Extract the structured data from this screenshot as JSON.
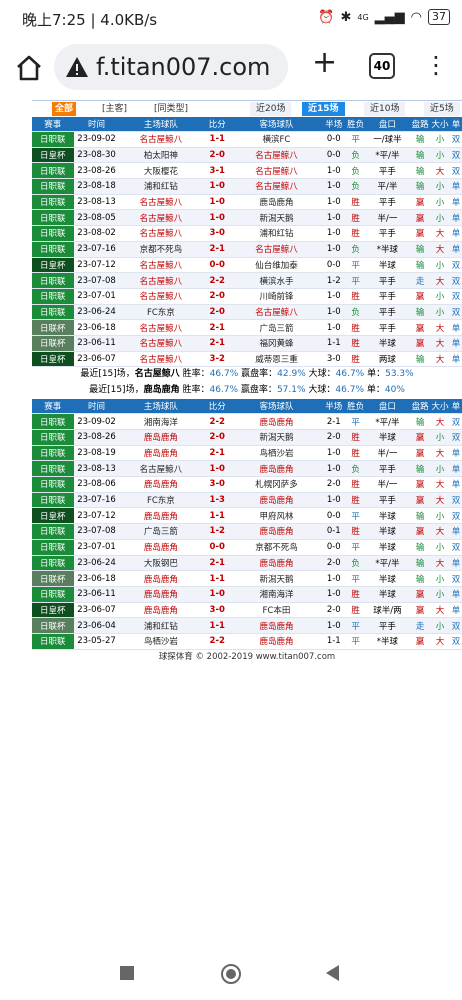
{
  "status": {
    "time": "晚上7:25 | 4.0KB/s",
    "signal": "4G",
    "battery": "37"
  },
  "browser": {
    "url": "f.titan007.com",
    "tab_count": "40"
  },
  "filters": {
    "all": "全部",
    "home_away": "[主客]",
    "same_type": "[同类型]",
    "counts": [
      "近20场",
      "近15场",
      "近10场",
      "近5场"
    ],
    "active": "近15场"
  },
  "columns": [
    "赛事",
    "时间",
    "主场球队",
    "比分",
    "客场球队",
    "半场",
    "胜负",
    "盘口",
    "盘路",
    "大小",
    "单"
  ],
  "table1": [
    {
      "lg": "日职联",
      "t": "23-09-02",
      "home": "名古屋鲸八",
      "score": "1-1",
      "away": "横滨FC",
      "half": "0-0",
      "res": "平",
      "hc": "一/球半",
      "pl": "输",
      "ou": "小",
      "oe": "双"
    },
    {
      "lg": "日皇杯",
      "t": "23-08-30",
      "home": "柏太阳神",
      "score": "2-0",
      "away": "名古屋鲸八",
      "half": "0-0",
      "res": "负",
      "hc": "*平/半",
      "pl": "输",
      "ou": "小",
      "oe": "双"
    },
    {
      "lg": "日职联",
      "t": "23-08-26",
      "home": "大阪樱花",
      "score": "3-1",
      "away": "名古屋鲸八",
      "half": "1-0",
      "res": "负",
      "hc": "平手",
      "pl": "输",
      "ou": "大",
      "oe": "双"
    },
    {
      "lg": "日职联",
      "t": "23-08-18",
      "home": "浦和红钻",
      "score": "1-0",
      "away": "名古屋鲸八",
      "half": "1-0",
      "res": "负",
      "hc": "平/半",
      "pl": "输",
      "ou": "小",
      "oe": "单"
    },
    {
      "lg": "日职联",
      "t": "23-08-13",
      "home": "名古屋鲸八",
      "score": "1-0",
      "away": "鹿岛鹿角",
      "half": "1-0",
      "res": "胜",
      "hc": "平手",
      "pl": "赢",
      "ou": "小",
      "oe": "单"
    },
    {
      "lg": "日职联",
      "t": "23-08-05",
      "home": "名古屋鲸八",
      "score": "1-0",
      "away": "新潟天鹅",
      "half": "1-0",
      "res": "胜",
      "hc": "半/一",
      "pl": "赢",
      "ou": "小",
      "oe": "单"
    },
    {
      "lg": "日职联",
      "t": "23-08-02",
      "home": "名古屋鲸八",
      "score": "3-0",
      "away": "浦和红钻",
      "half": "1-0",
      "res": "胜",
      "hc": "平手",
      "pl": "赢",
      "ou": "大",
      "oe": "单"
    },
    {
      "lg": "日职联",
      "t": "23-07-16",
      "home": "京都不死鸟",
      "score": "2-1",
      "away": "名古屋鲸八",
      "half": "1-0",
      "res": "负",
      "hc": "*半球",
      "pl": "输",
      "ou": "大",
      "oe": "单"
    },
    {
      "lg": "日皇杯",
      "t": "23-07-12",
      "home": "名古屋鲸八",
      "score": "0-0",
      "away": "仙台维加泰",
      "half": "0-0",
      "res": "平",
      "hc": "半球",
      "pl": "输",
      "ou": "小",
      "oe": "双"
    },
    {
      "lg": "日职联",
      "t": "23-07-08",
      "home": "名古屋鲸八",
      "score": "2-2",
      "away": "横滨水手",
      "half": "1-2",
      "res": "平",
      "hc": "平手",
      "pl": "走",
      "ou": "大",
      "oe": "双"
    },
    {
      "lg": "日职联",
      "t": "23-07-01",
      "home": "名古屋鲸八",
      "score": "2-0",
      "away": "川崎前锋",
      "half": "1-0",
      "res": "胜",
      "hc": "平手",
      "pl": "赢",
      "ou": "小",
      "oe": "双"
    },
    {
      "lg": "日职联",
      "t": "23-06-24",
      "home": "FC东京",
      "score": "2-0",
      "away": "名古屋鲸八",
      "half": "1-0",
      "res": "负",
      "hc": "平手",
      "pl": "输",
      "ou": "小",
      "oe": "双"
    },
    {
      "lg": "日联杯",
      "t": "23-06-18",
      "home": "名古屋鲸八",
      "score": "2-1",
      "away": "广岛三箭",
      "half": "1-0",
      "res": "胜",
      "hc": "平手",
      "pl": "赢",
      "ou": "大",
      "oe": "单"
    },
    {
      "lg": "日联杯",
      "t": "23-06-11",
      "home": "名古屋鲸八",
      "score": "2-1",
      "away": "福冈黄蜂",
      "half": "1-1",
      "res": "胜",
      "hc": "半球",
      "pl": "赢",
      "ou": "大",
      "oe": "单"
    },
    {
      "lg": "日皇杯",
      "t": "23-06-07",
      "home": "名古屋鲸八",
      "score": "3-2",
      "away": "威蒂恩三重",
      "half": "3-0",
      "res": "胜",
      "hc": "两球",
      "pl": "输",
      "ou": "大",
      "oe": "单"
    }
  ],
  "summary1": {
    "pre": "最近[15]场，",
    "team": "名古屋鲸八",
    "win_l": " 胜率：",
    "win": "46.7%",
    "hcw_l": " 赢盘率：",
    "hcw": "42.9%",
    "big_l": " 大球：",
    "big": "46.7%",
    "odd_l": " 单：",
    "odd": "53.3%"
  },
  "summary2": {
    "pre": "最近[15]场，",
    "team": "鹿岛鹿角",
    "win_l": " 胜率：",
    "win": "46.7%",
    "hcw_l": " 赢盘率：",
    "hcw": "57.1%",
    "big_l": " 大球：",
    "big": "46.7%",
    "odd_l": " 单：",
    "odd": "40%"
  },
  "table2": [
    {
      "lg": "日职联",
      "t": "23-09-02",
      "home": "湘南海洋",
      "score": "2-2",
      "away": "鹿岛鹿角",
      "half": "2-1",
      "res": "平",
      "hc": "*平/半",
      "pl": "输",
      "ou": "大",
      "oe": "双"
    },
    {
      "lg": "日职联",
      "t": "23-08-26",
      "home": "鹿岛鹿角",
      "score": "2-0",
      "away": "新潟天鹅",
      "half": "2-0",
      "res": "胜",
      "hc": "半球",
      "pl": "赢",
      "ou": "小",
      "oe": "双"
    },
    {
      "lg": "日职联",
      "t": "23-08-19",
      "home": "鹿岛鹿角",
      "score": "2-1",
      "away": "鸟栖沙岩",
      "half": "1-0",
      "res": "胜",
      "hc": "半/一",
      "pl": "赢",
      "ou": "大",
      "oe": "单"
    },
    {
      "lg": "日职联",
      "t": "23-08-13",
      "home": "名古屋鲸八",
      "score": "1-0",
      "away": "鹿岛鹿角",
      "half": "1-0",
      "res": "负",
      "hc": "平手",
      "pl": "输",
      "ou": "小",
      "oe": "单"
    },
    {
      "lg": "日职联",
      "t": "23-08-06",
      "home": "鹿岛鹿角",
      "score": "3-0",
      "away": "札幌冈萨多",
      "half": "2-0",
      "res": "胜",
      "hc": "半/一",
      "pl": "赢",
      "ou": "大",
      "oe": "单"
    },
    {
      "lg": "日职联",
      "t": "23-07-16",
      "home": "FC东京",
      "score": "1-3",
      "away": "鹿岛鹿角",
      "half": "1-0",
      "res": "胜",
      "hc": "平手",
      "pl": "赢",
      "ou": "大",
      "oe": "双"
    },
    {
      "lg": "日皇杯",
      "t": "23-07-12",
      "home": "鹿岛鹿角",
      "score": "1-1",
      "away": "甲府风林",
      "half": "0-0",
      "res": "平",
      "hc": "半球",
      "pl": "输",
      "ou": "小",
      "oe": "双"
    },
    {
      "lg": "日职联",
      "t": "23-07-08",
      "home": "广岛三箭",
      "score": "1-2",
      "away": "鹿岛鹿角",
      "half": "0-1",
      "res": "胜",
      "hc": "半球",
      "pl": "赢",
      "ou": "大",
      "oe": "单"
    },
    {
      "lg": "日职联",
      "t": "23-07-01",
      "home": "鹿岛鹿角",
      "score": "0-0",
      "away": "京都不死鸟",
      "half": "0-0",
      "res": "平",
      "hc": "半球",
      "pl": "输",
      "ou": "小",
      "oe": "双"
    },
    {
      "lg": "日职联",
      "t": "23-06-24",
      "home": "大阪钢巴",
      "score": "2-1",
      "away": "鹿岛鹿角",
      "half": "2-0",
      "res": "负",
      "hc": "*平/半",
      "pl": "输",
      "ou": "大",
      "oe": "单"
    },
    {
      "lg": "日联杯",
      "t": "23-06-18",
      "home": "鹿岛鹿角",
      "score": "1-1",
      "away": "新潟天鹅",
      "half": "1-0",
      "res": "平",
      "hc": "半球",
      "pl": "输",
      "ou": "小",
      "oe": "双"
    },
    {
      "lg": "日职联",
      "t": "23-06-11",
      "home": "鹿岛鹿角",
      "score": "1-0",
      "away": "湘南海洋",
      "half": "1-0",
      "res": "胜",
      "hc": "半球",
      "pl": "赢",
      "ou": "小",
      "oe": "单"
    },
    {
      "lg": "日皇杯",
      "t": "23-06-07",
      "home": "鹿岛鹿角",
      "score": "3-0",
      "away": "FC本田",
      "half": "2-0",
      "res": "胜",
      "hc": "球半/两",
      "pl": "赢",
      "ou": "大",
      "oe": "单"
    },
    {
      "lg": "日联杯",
      "t": "23-06-04",
      "home": "浦和红钻",
      "score": "1-1",
      "away": "鹿岛鹿角",
      "half": "1-0",
      "res": "平",
      "hc": "平手",
      "pl": "走",
      "ou": "小",
      "oe": "双"
    },
    {
      "lg": "日职联",
      "t": "23-05-27",
      "home": "鸟栖沙岩",
      "score": "2-2",
      "away": "鹿岛鹿角",
      "half": "1-1",
      "res": "平",
      "hc": "*半球",
      "pl": "赢",
      "ou": "大",
      "oe": "双"
    }
  ],
  "footer": "球探体育 © 2002-2019 www.titan007.com"
}
